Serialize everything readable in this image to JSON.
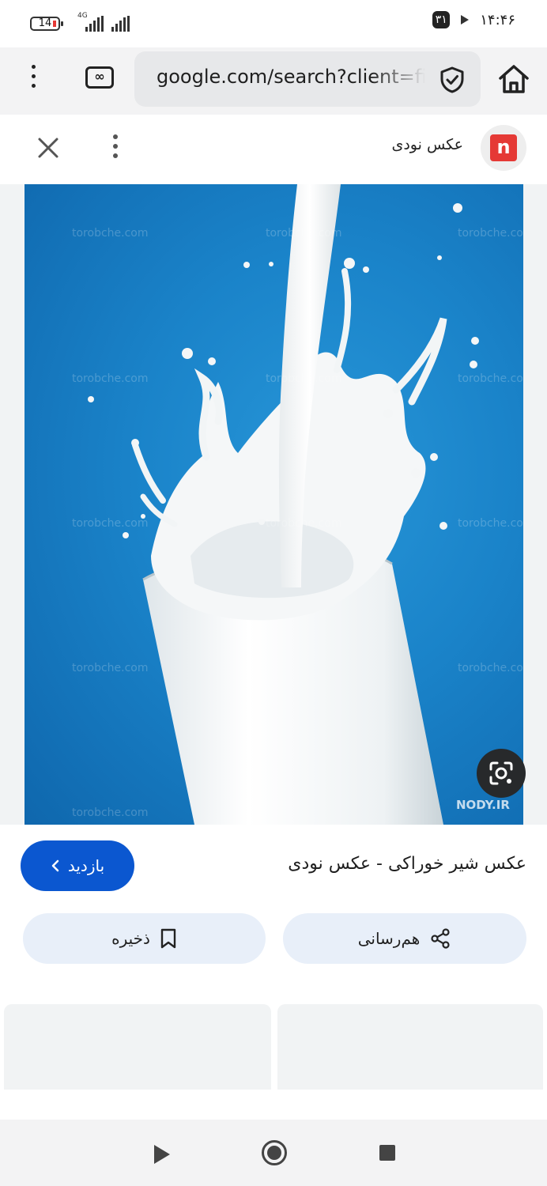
{
  "status_bar": {
    "battery_level": "14",
    "network_type": "4G",
    "calendar_badge": "۳۱",
    "time": "۱۴:۴۶"
  },
  "browser_toolbar": {
    "url": "google.com/search?client=firefox",
    "tabs_symbol": "∞"
  },
  "result_header": {
    "site_name": "عکس نودی",
    "site_logo_letter": "n"
  },
  "image": {
    "watermarks": [
      "torobche.com",
      "torobche.com",
      "torobche.com",
      "torobche.com",
      "torobche.com",
      "torobche.com",
      "torobche.com",
      "torobche.com",
      "torobche.com",
      "torobche.com",
      "torobche.com",
      "torobche.com",
      "NODY.IR"
    ],
    "background_color": "#1a83c9"
  },
  "details": {
    "caption": "عکس شیر خوراکی - عکس نودی",
    "visit_label": "بازدید",
    "share_label": "هم‌رسانی",
    "save_label": "ذخیره"
  },
  "colors": {
    "primary_button": "#0b57d0",
    "chip_background": "#e8eff9",
    "logo_red": "#e53935"
  }
}
